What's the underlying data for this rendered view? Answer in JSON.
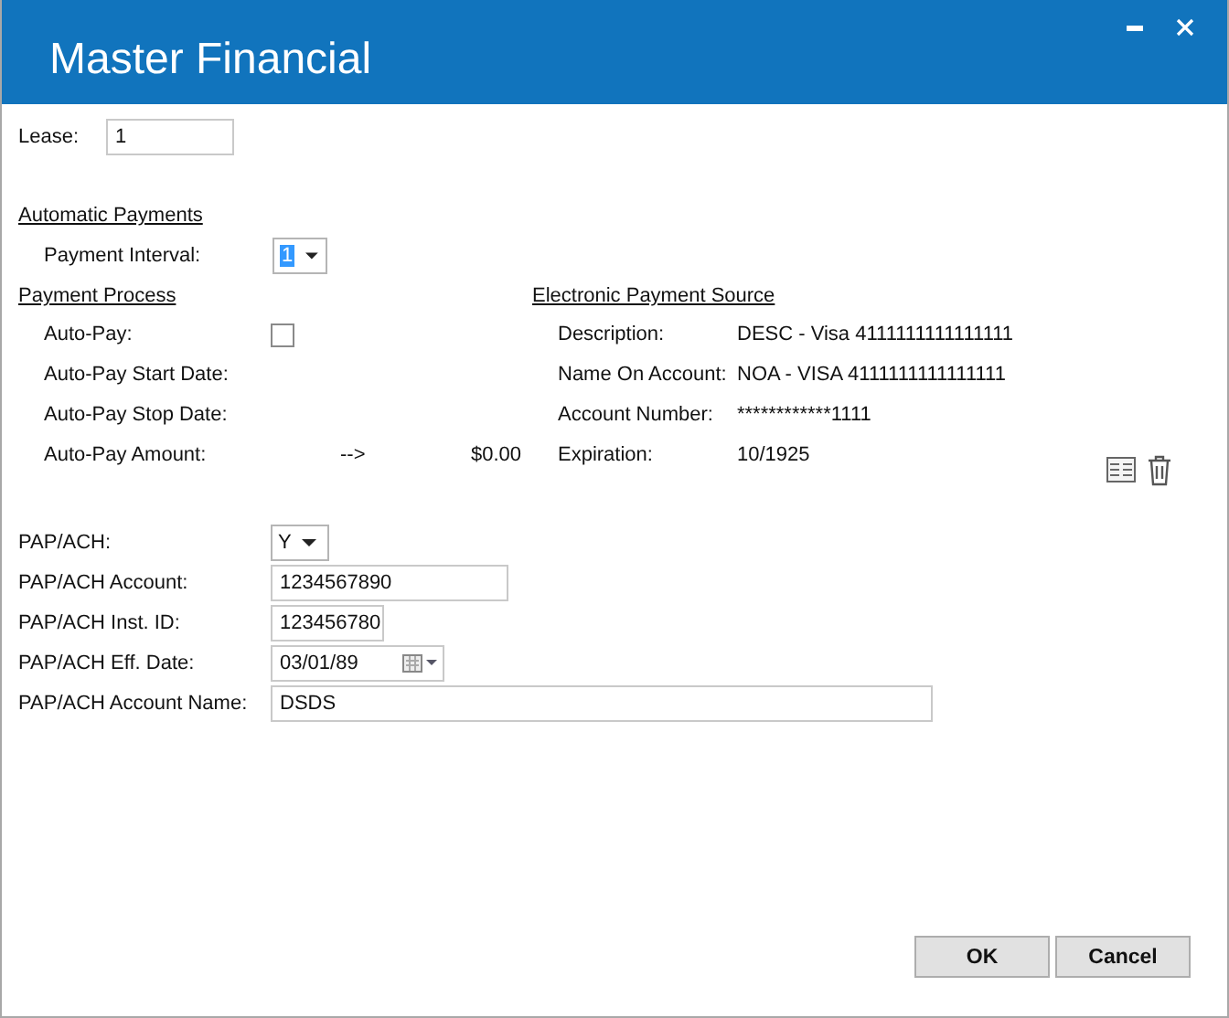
{
  "window": {
    "title": "Master Financial"
  },
  "lease": {
    "label": "Lease:",
    "value": "1"
  },
  "automatic_payments": {
    "heading": "Automatic Payments",
    "payment_interval": {
      "label": "Payment Interval:",
      "value": "1",
      "focused": true
    }
  },
  "payment_process": {
    "heading": "Payment Process",
    "rows": [
      {
        "kind": "checkbox",
        "label": "Auto-Pay:",
        "checked": false
      },
      {
        "kind": "plain",
        "label": "Auto-Pay Start Date:"
      },
      {
        "kind": "plain",
        "label": "Auto-Pay Stop Date:"
      },
      {
        "kind": "amount",
        "label": "Auto-Pay Amount:",
        "arrow": "-->",
        "amount": "$0.00"
      }
    ]
  },
  "electronic_payment_source": {
    "heading": "Electronic Payment Source",
    "rows": [
      {
        "label": "Description:",
        "value": "DESC - Visa 4111111111111111"
      },
      {
        "label": "Name On Account:",
        "value": "NOA - VISA 4111111111111111"
      },
      {
        "label": "Account Number:",
        "value": "************1111"
      },
      {
        "label": "Expiration:",
        "value": "10/1925"
      }
    ]
  },
  "pap_fields": [
    {
      "kind": "dropdown",
      "label": "PAP/ACH:",
      "value": "Y"
    },
    {
      "kind": "text",
      "label": "PAP/ACH Account:",
      "value": "1234567890"
    },
    {
      "kind": "text",
      "label": "PAP/ACH Inst. ID:",
      "value": "123456780"
    },
    {
      "kind": "date",
      "label": "PAP/ACH Eff. Date:",
      "value": "03/01/89"
    },
    {
      "kind": "text",
      "label": "PAP/ACH Account Name:",
      "value": "DSDS"
    }
  ],
  "buttons": [
    "OK",
    "Cancel"
  ]
}
